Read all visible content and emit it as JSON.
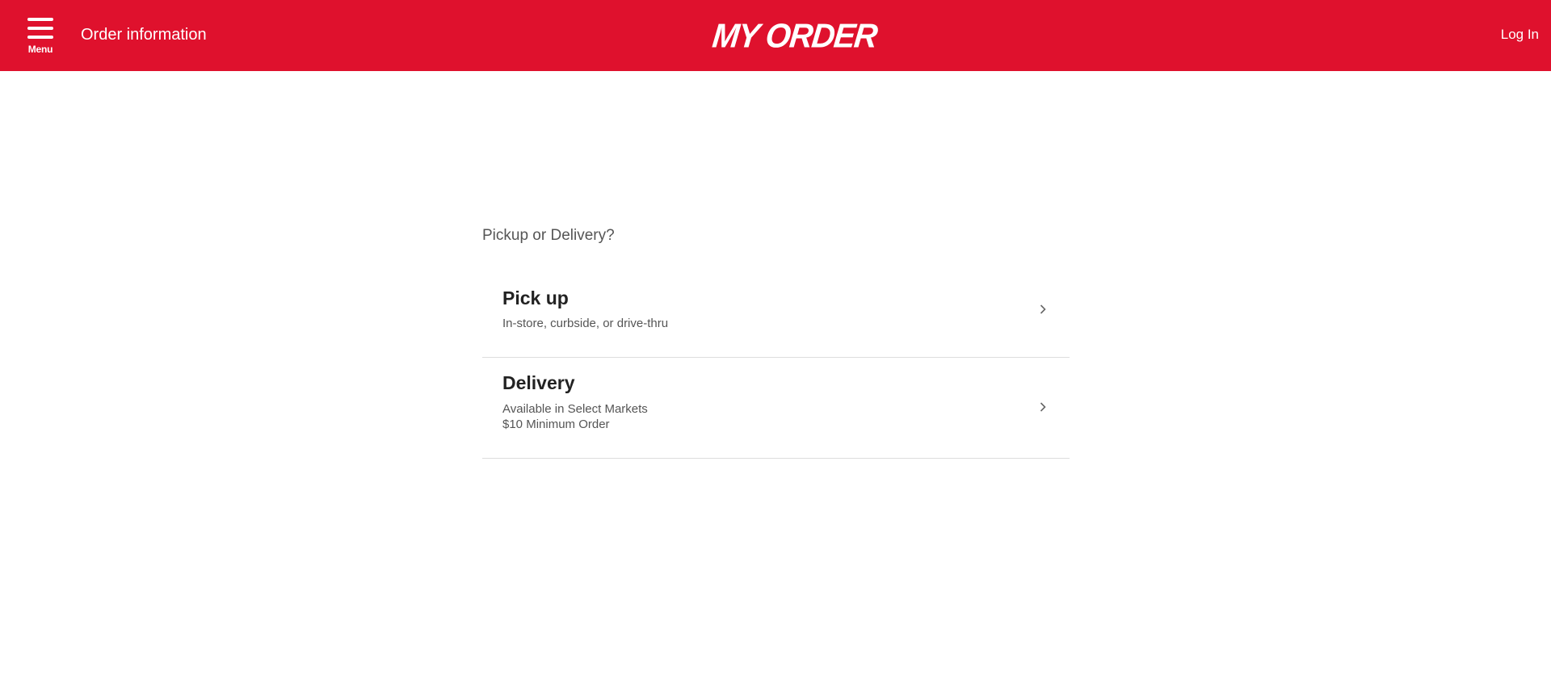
{
  "header": {
    "menu_label": "Menu",
    "title": "Order information",
    "logo_text": "MY ORDER",
    "login_label": "Log In",
    "background_color": "#df112d"
  },
  "main": {
    "question": "Pickup or Delivery?",
    "options": [
      {
        "title": "Pick up",
        "subtitle_lines": [
          "In-store, curbside, or drive-thru"
        ],
        "icon": "chevron-right-icon"
      },
      {
        "title": "Delivery",
        "subtitle_lines": [
          "Available in Select Markets",
          "$10 Minimum Order"
        ],
        "icon": "chevron-right-icon"
      }
    ]
  }
}
